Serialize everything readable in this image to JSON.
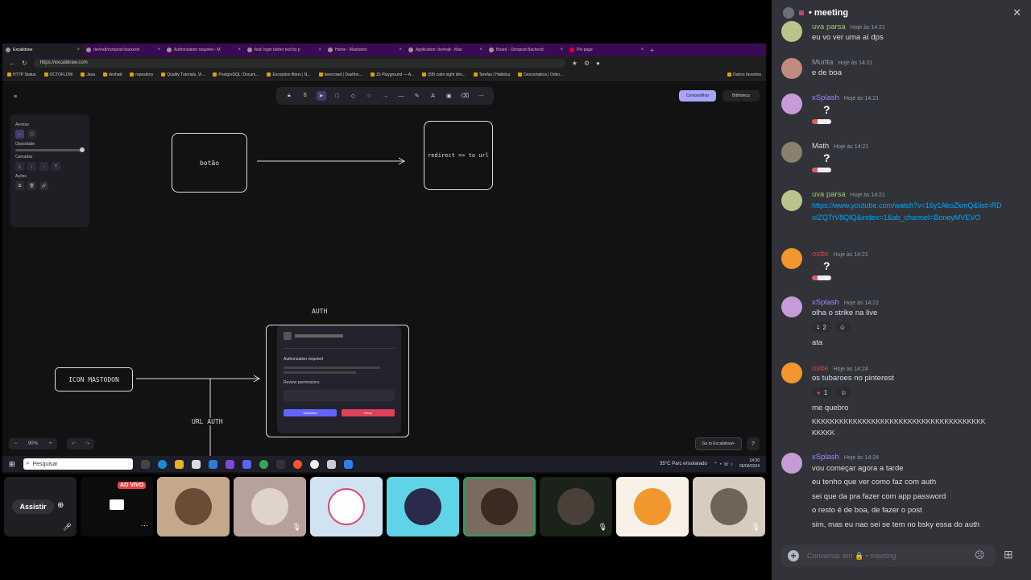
{
  "browser": {
    "tabs": [
      {
        "label": "Excalidraw",
        "active": true
      },
      {
        "label": "devhatt/octopost-backend",
        "active": false
      },
      {
        "label": "Authorization required - M",
        "active": false
      },
      {
        "label": "feat: login twitter test by p",
        "active": false
      },
      {
        "label": "Home - Mastodon",
        "active": false
      },
      {
        "label": "Application: devhatt - Mas",
        "active": false
      },
      {
        "label": "Board · Octopost Backend",
        "active": false
      },
      {
        "label": "Pin page",
        "active": false
      }
    ],
    "url": "https://excalidraw.com",
    "bookmarks": [
      "HTTP Status",
      "OCTOFLOW",
      "Java",
      "devhatt",
      "repository",
      "Quality Tutorials, Vi...",
      "PostgreSQL: Docum...",
      "Exception filters | N...",
      "beecrowd | Dashbo...",
      "JS Playground — A...",
      "(58) calm night driv...",
      "Tarefas | Habitica",
      "Descomplica | Onbo...",
      "Outros favoritos"
    ]
  },
  "excalidraw": {
    "props": {
      "edges_label": "Arestas",
      "opacity_label": "Opacidade",
      "layers_label": "Camadas",
      "actions_label": "Ações"
    },
    "share_label": "Compartilhar",
    "library_label": "Biblioteca",
    "zoom": "90%",
    "goto_label": "Go to Excalidraw+",
    "shapes": {
      "button_text": "botão",
      "redirect_text": "redirect => to url",
      "auth_text": "AUTH",
      "icon_mastodon_text": "ICON MASTODON",
      "url_auth_text": "URL AUTH"
    },
    "embed": {
      "title": "Authorization required",
      "subtitle": "Review permissions",
      "deny": "Authorize",
      "allow": "Deny"
    }
  },
  "taskbar": {
    "search_placeholder": "Pesquisar",
    "weather": "35°C  Parc ensolarado",
    "time": "14:30",
    "date": "06/09/2024"
  },
  "tiles": {
    "watch_label": "Assistir",
    "live_label": "AO VIVO"
  },
  "chat": {
    "channel": "meeting",
    "composer_placeholder": "Conversar em  🔒 • meeting",
    "messages": [
      {
        "user": "uva parsa",
        "time": "Hoje às 14:21",
        "color": "#a3c46e",
        "lines": [
          "eu vo ver uma aí dps"
        ]
      },
      {
        "user": "Murita",
        "time": "Hoje às 14:21",
        "color": "#949ba4",
        "lines": [
          "e de boa"
        ]
      },
      {
        "user": "xSplash",
        "time": "Hoje às 14:21",
        "color": "#9b8bff",
        "sticker": true
      },
      {
        "user": "Math",
        "time": "Hoje às 14:21",
        "color": "#dbdee1",
        "sticker": true
      },
      {
        "user": "uva parsa",
        "time": "Hoje às 14:21",
        "color": "#a3c46e",
        "link": "https://www.youtube.com/watch?v=16y1AkoZkmQ&list=RDuIZQTrV8QIQ&index=1&ab_channel=BoneyMVEVO"
      },
      {
        "user": "ostte",
        "time": "Hoje às 14:21",
        "color": "#e03d3d",
        "sticker": true
      },
      {
        "user": "xSplash",
        "time": "Hoje às 14:22",
        "color": "#9b8bff",
        "lines": [
          "olha o strike na live"
        ],
        "reaction": "2",
        "extra": "ata"
      },
      {
        "user": "ostte",
        "time": "Hoje às 14:24",
        "color": "#e03d3d",
        "lines": [
          "os tubaroes no pinterest"
        ],
        "reaction": "1",
        "extra": "me quebro",
        "extra2": "KKKKKKKKKKKKKKKKKKKKKKKKKKKKKKKKKKKKKK",
        "extra3": "KKKKK"
      },
      {
        "user": "xSplash",
        "time": "Hoje às 14:24",
        "color": "#9b8bff",
        "lines": [
          "vou começar agora a tarde",
          "eu tenho que ver como faz com auth",
          "sei que da pra fazer com app password",
          "o resto é de boa, de fazer o post",
          "sim, mas eu nao sei se tem no bsky essa do auth"
        ]
      }
    ]
  },
  "colors": {
    "accent": "#a8a5ff",
    "tabbar": "#3a0b52",
    "chat_bg": "#313338",
    "link": "#00a8fc"
  }
}
